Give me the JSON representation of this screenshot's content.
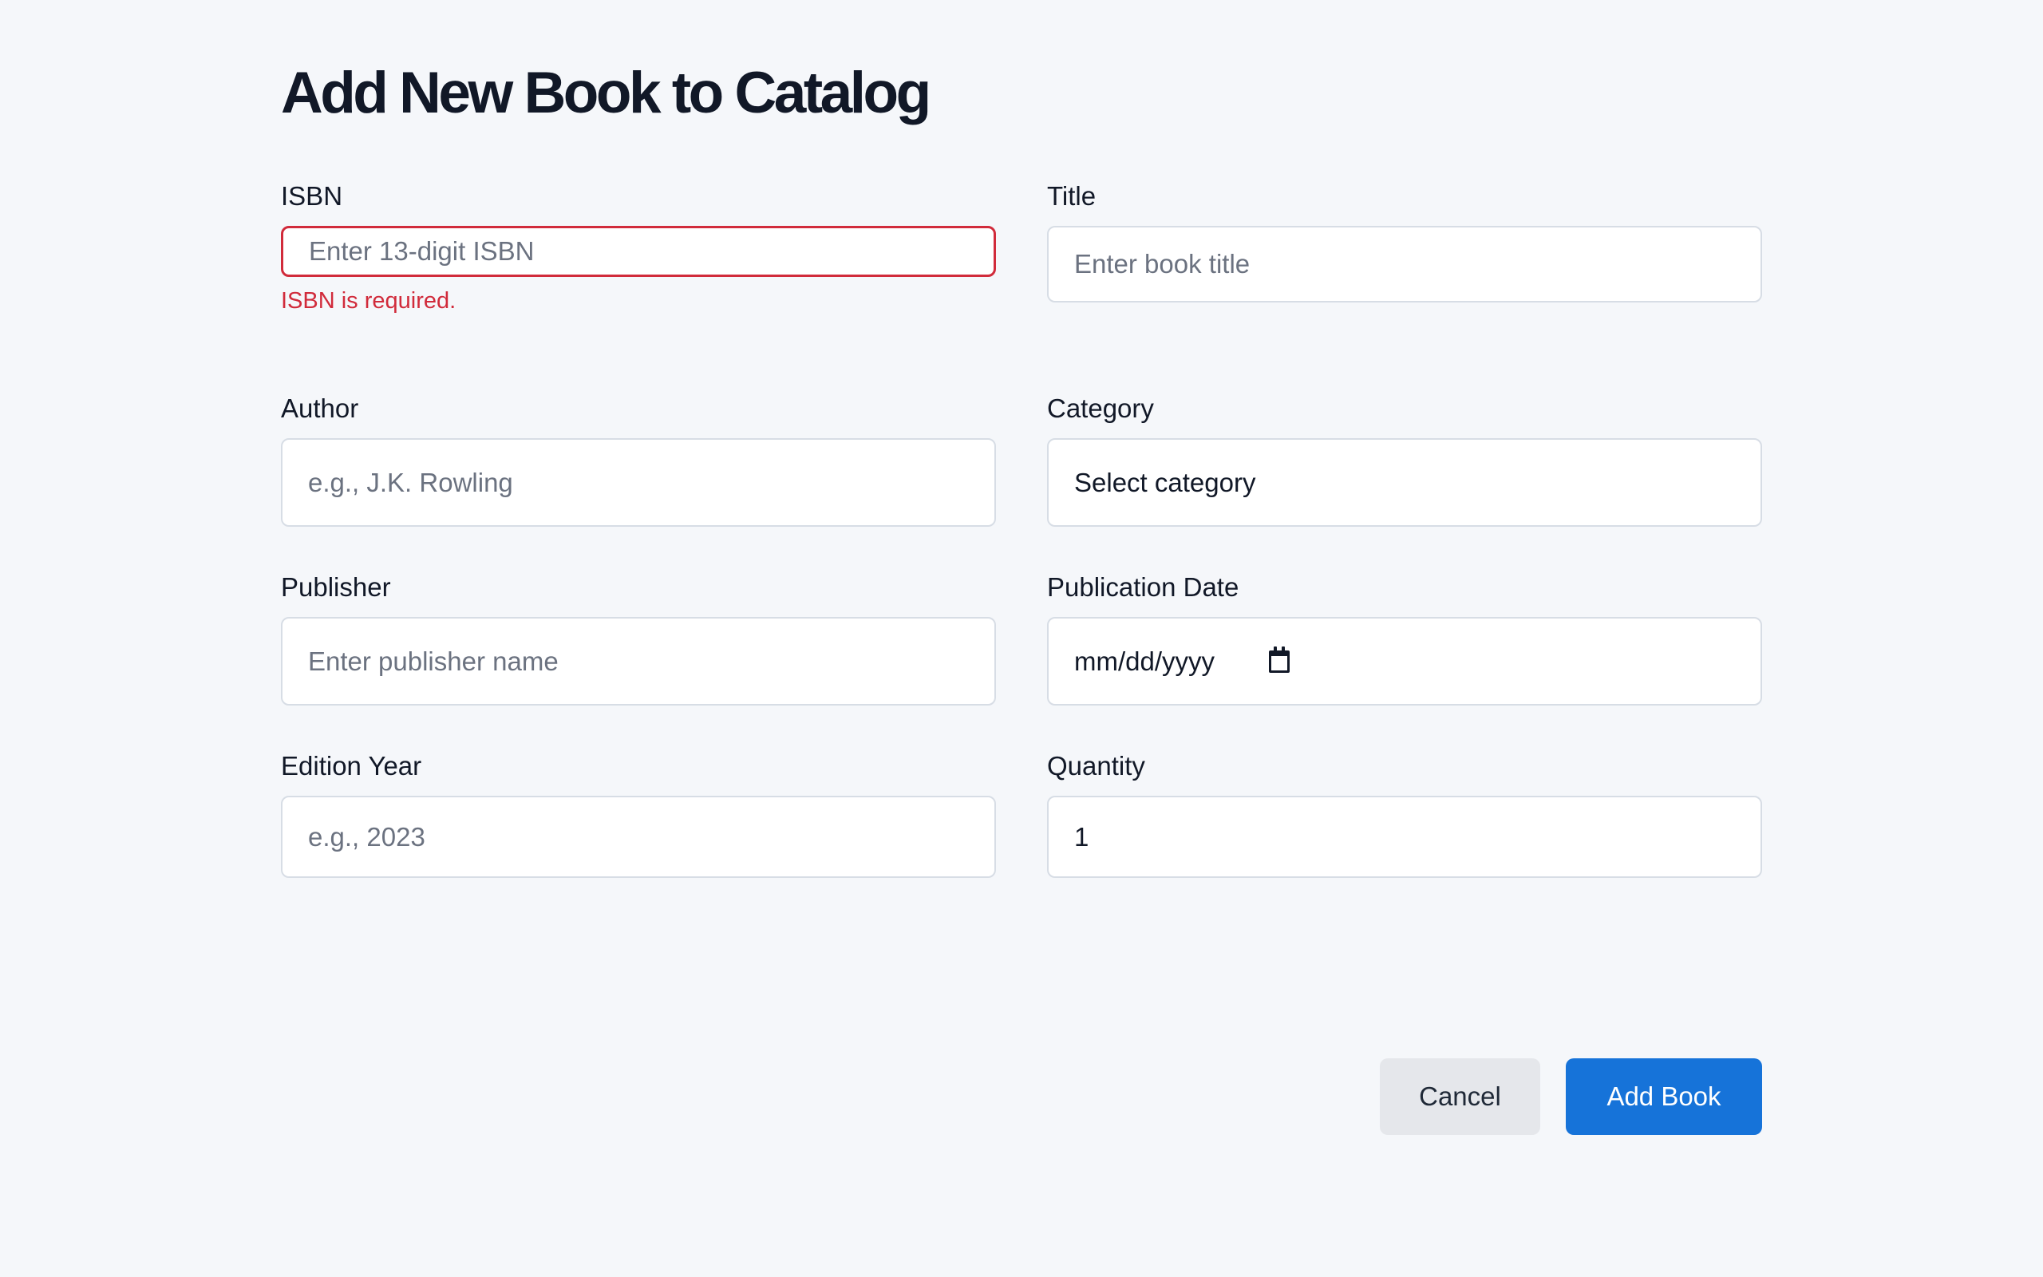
{
  "page": {
    "title": "Add New Book to Catalog"
  },
  "form": {
    "isbn": {
      "label": "ISBN",
      "placeholder": "Enter 13-digit ISBN",
      "error": "ISBN is required."
    },
    "title": {
      "label": "Title",
      "placeholder": "Enter book title"
    },
    "author": {
      "label": "Author",
      "placeholder": "e.g., J.K. Rowling"
    },
    "category": {
      "label": "Category",
      "selected": "Select category"
    },
    "publisher": {
      "label": "Publisher",
      "placeholder": "Enter publisher name"
    },
    "publication_date": {
      "label": "Publication Date",
      "value": "mm/dd/yyyy"
    },
    "edition_year": {
      "label": "Edition Year",
      "placeholder": "e.g., 2023"
    },
    "quantity": {
      "label": "Quantity",
      "value": "1"
    }
  },
  "actions": {
    "cancel_label": "Cancel",
    "submit_label": "Add Book"
  },
  "colors": {
    "background": "#f5f7fa",
    "primary": "#1673d9",
    "error": "#d12b3b",
    "border": "#d7dde5",
    "text": "#111827",
    "placeholder": "#6b7280",
    "secondary_button": "#e5e7eb"
  },
  "icons": {
    "date_picker": "calendar-icon"
  }
}
